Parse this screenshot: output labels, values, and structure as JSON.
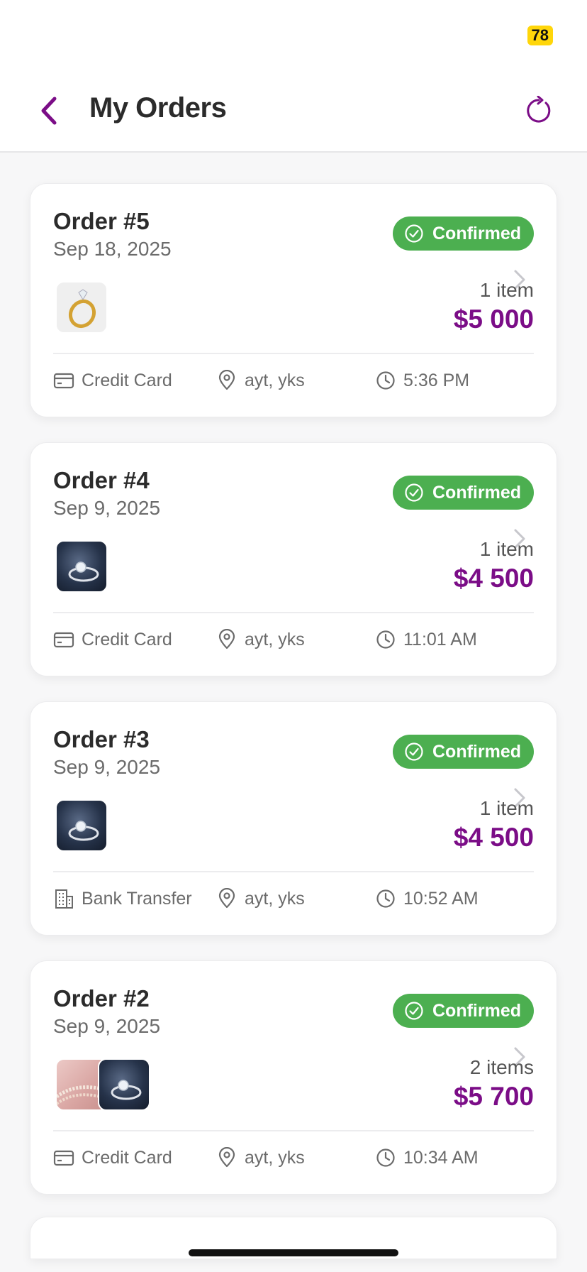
{
  "status_bar": {
    "battery": "78"
  },
  "header": {
    "title": "My Orders"
  },
  "orders": [
    {
      "number": "Order #5",
      "date": "Sep 18, 2025",
      "status": "Confirmed",
      "items": "1 item",
      "total": "$5 000",
      "payment": "Credit Card",
      "payment_icon": "credit-card",
      "location": "ayt, yks",
      "time": "5:36 PM",
      "thumbnails": [
        "gold-ring"
      ]
    },
    {
      "number": "Order #4",
      "date": "Sep 9, 2025",
      "status": "Confirmed",
      "items": "1 item",
      "total": "$4 500",
      "payment": "Credit Card",
      "payment_icon": "credit-card",
      "location": "ayt, yks",
      "time": "11:01 AM",
      "thumbnails": [
        "diamond-ring"
      ]
    },
    {
      "number": "Order #3",
      "date": "Sep 9, 2025",
      "status": "Confirmed",
      "items": "1 item",
      "total": "$4 500",
      "payment": "Bank Transfer",
      "payment_icon": "bank-building",
      "location": "ayt, yks",
      "time": "10:52 AM",
      "thumbnails": [
        "diamond-ring"
      ]
    },
    {
      "number": "Order #2",
      "date": "Sep 9, 2025",
      "status": "Confirmed",
      "items": "2 items",
      "total": "$5 700",
      "payment": "Credit Card",
      "payment_icon": "credit-card",
      "location": "ayt, yks",
      "time": "10:34 AM",
      "thumbnails": [
        "pearl-bracelet",
        "diamond-ring"
      ]
    }
  ],
  "colors": {
    "accent": "#7b0d87",
    "status_confirmed": "#4caf50",
    "battery": "#ffd60a"
  }
}
